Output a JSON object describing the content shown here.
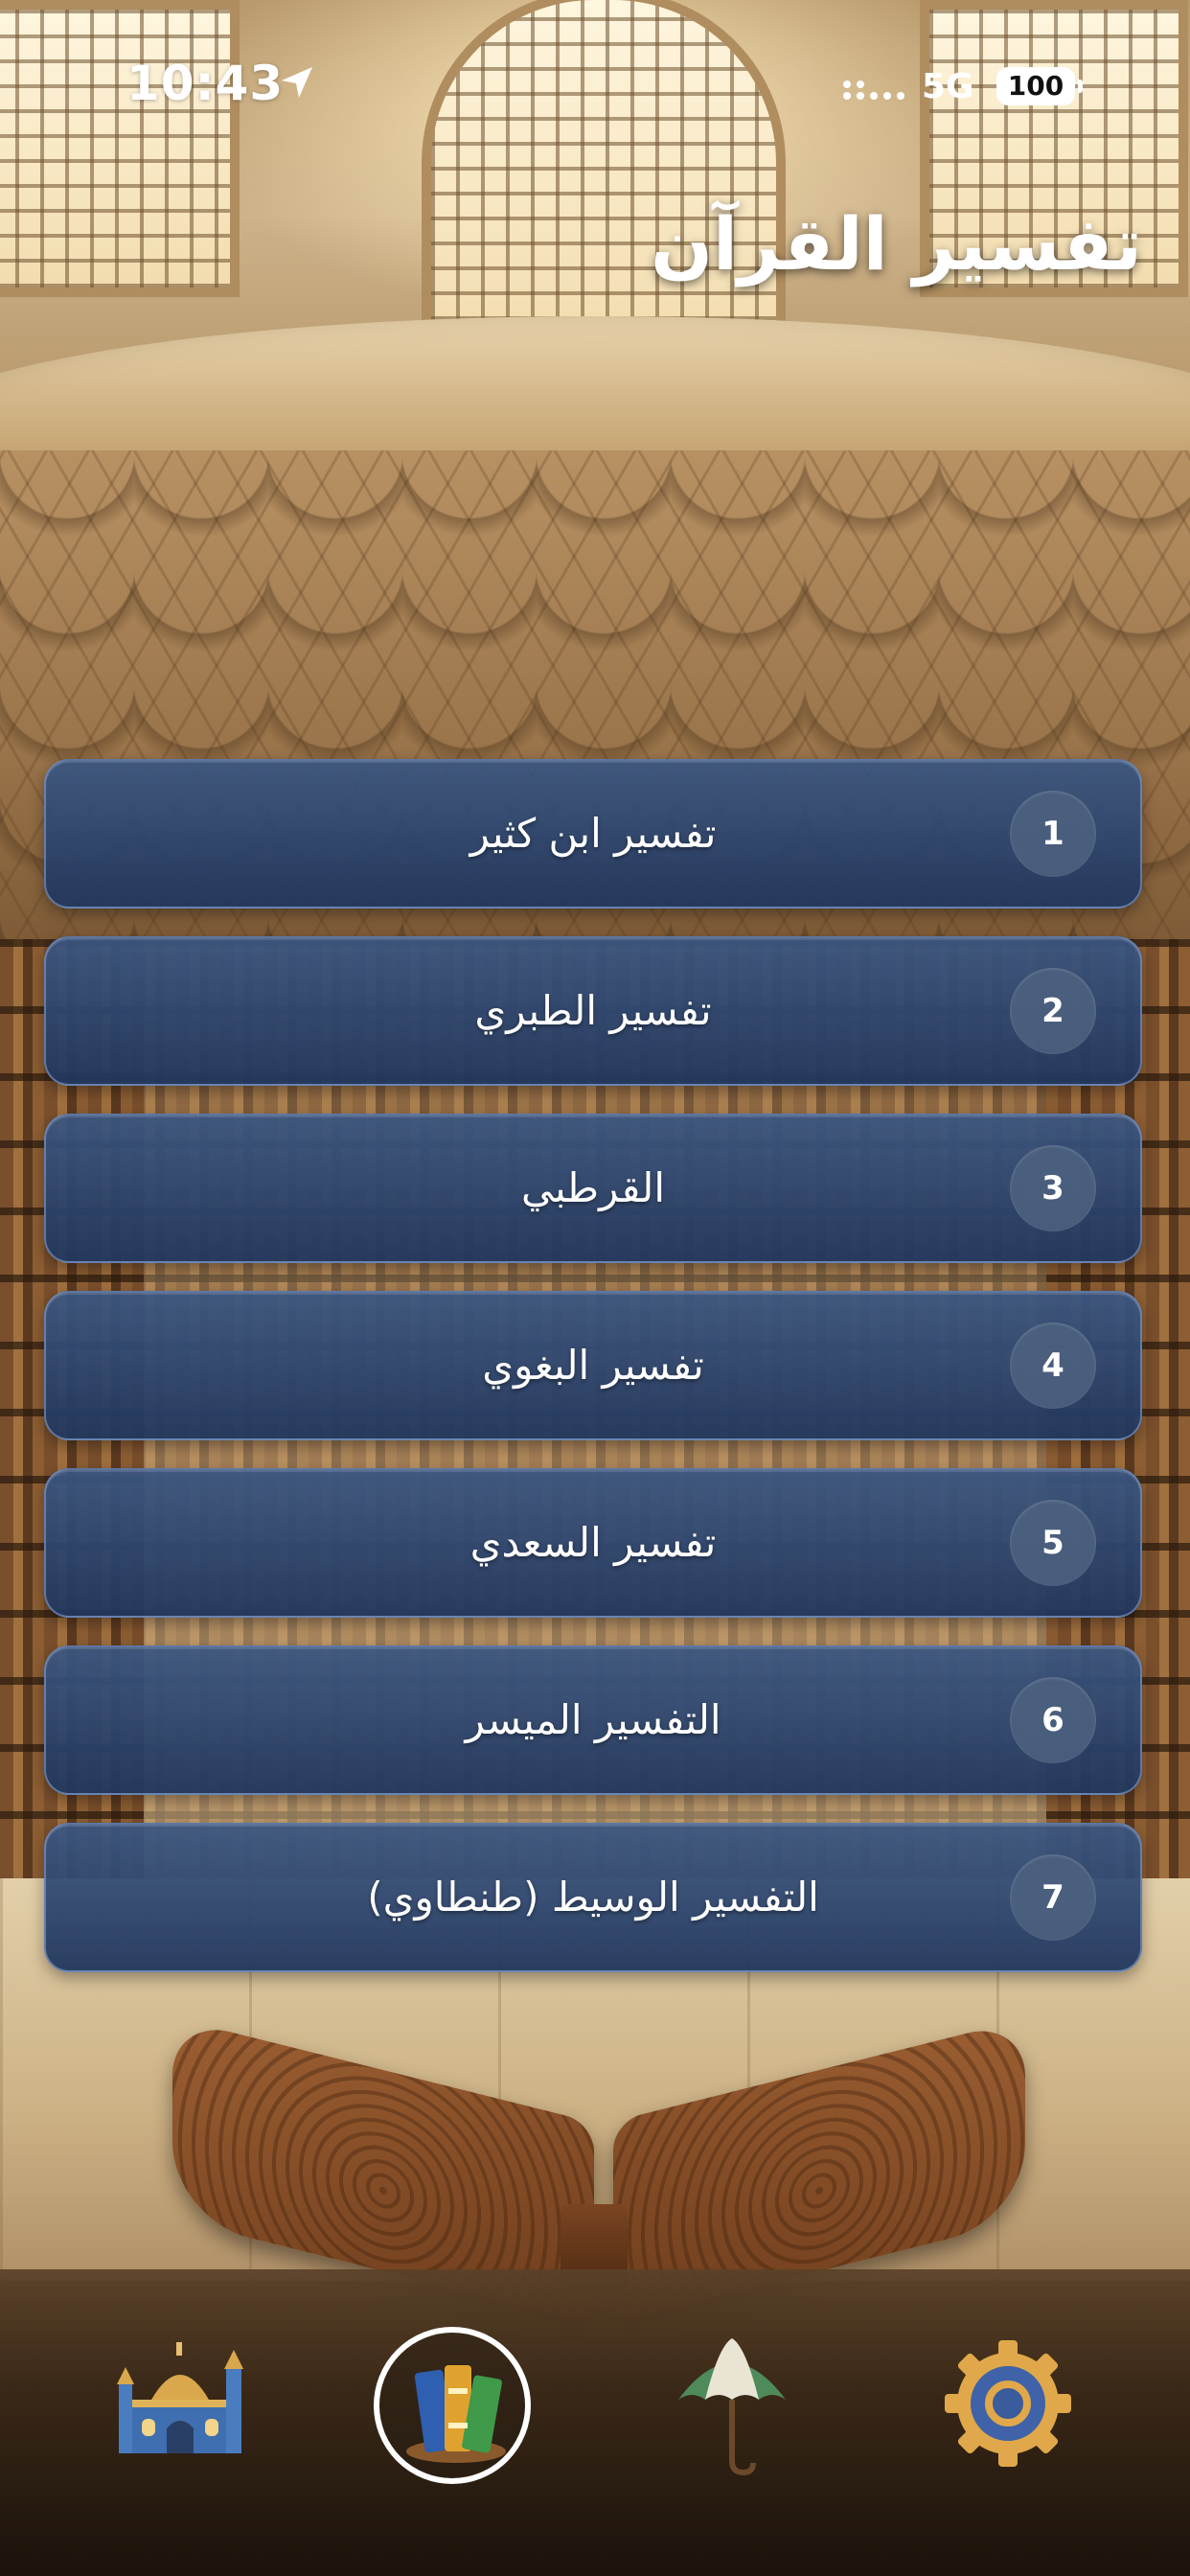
{
  "status_bar": {
    "time": "10:43",
    "network": "5G",
    "battery": "100"
  },
  "header": {
    "title": "تفسير القرآن"
  },
  "tafsir_list": [
    {
      "number": "1",
      "label": "تفسير ابن كثير"
    },
    {
      "number": "2",
      "label": "تفسير الطبري"
    },
    {
      "number": "3",
      "label": "القرطبي"
    },
    {
      "number": "4",
      "label": "تفسير البغوي"
    },
    {
      "number": "5",
      "label": "تفسير السعدي"
    },
    {
      "number": "6",
      "label": "التفسير الميسر"
    },
    {
      "number": "7",
      "label": "التفسير الوسيط (طنطاوي)"
    }
  ],
  "tab_bar": {
    "tabs": [
      {
        "icon": "mosque-icon",
        "selected": false
      },
      {
        "icon": "books-icon",
        "selected": true
      },
      {
        "icon": "umbrella-icon",
        "selected": false
      },
      {
        "icon": "gear-icon",
        "selected": false
      }
    ]
  },
  "colors": {
    "card_top": "#3a5682",
    "card_bottom": "#21375e",
    "number_badge": "#4e6280",
    "text": "#ffffff"
  }
}
